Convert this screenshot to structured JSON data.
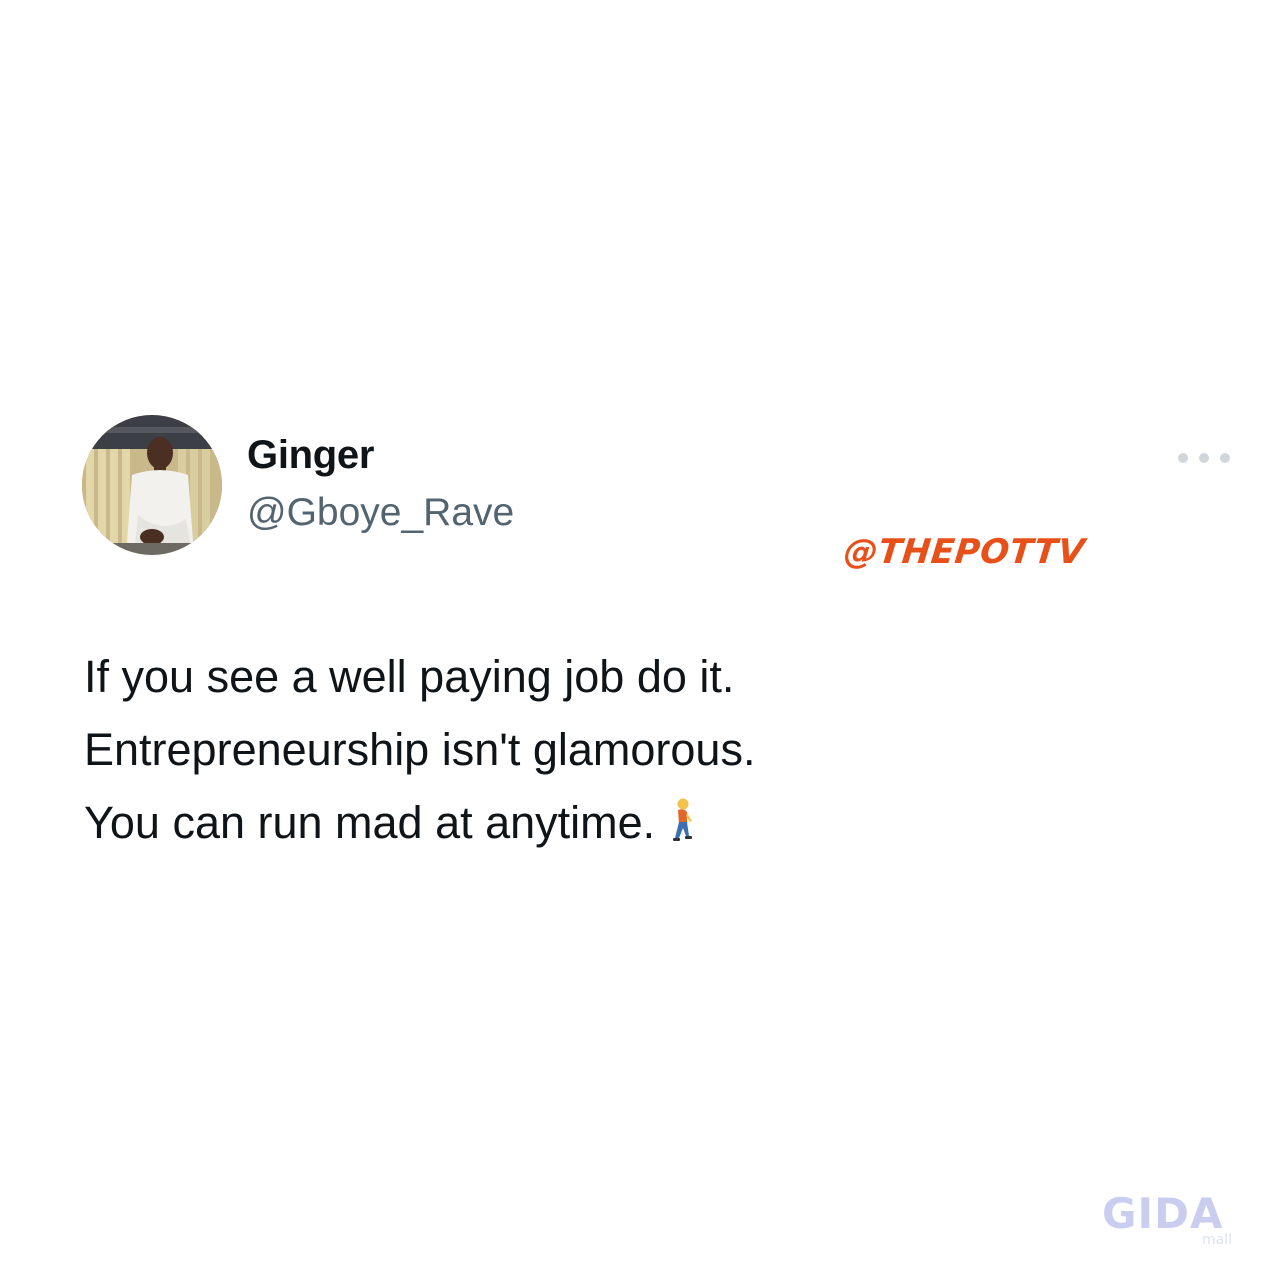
{
  "tweet": {
    "display_name": "Ginger",
    "handle": "@Gboye_Rave",
    "text_lines": [
      "If you see a well paying job do it.",
      "Entrepreneurship isn't glamorous.",
      "You can run mad at anytime."
    ],
    "emoji": "walking-person-emoji"
  },
  "watermark": {
    "text": "@THEPOTTV",
    "color": "#e8501a"
  },
  "brand_logo": {
    "text": "GIDA",
    "subtext": "mall",
    "color": "#c9cdf0"
  },
  "icons": {
    "more": "more-options-icon",
    "avatar": "profile-avatar"
  }
}
